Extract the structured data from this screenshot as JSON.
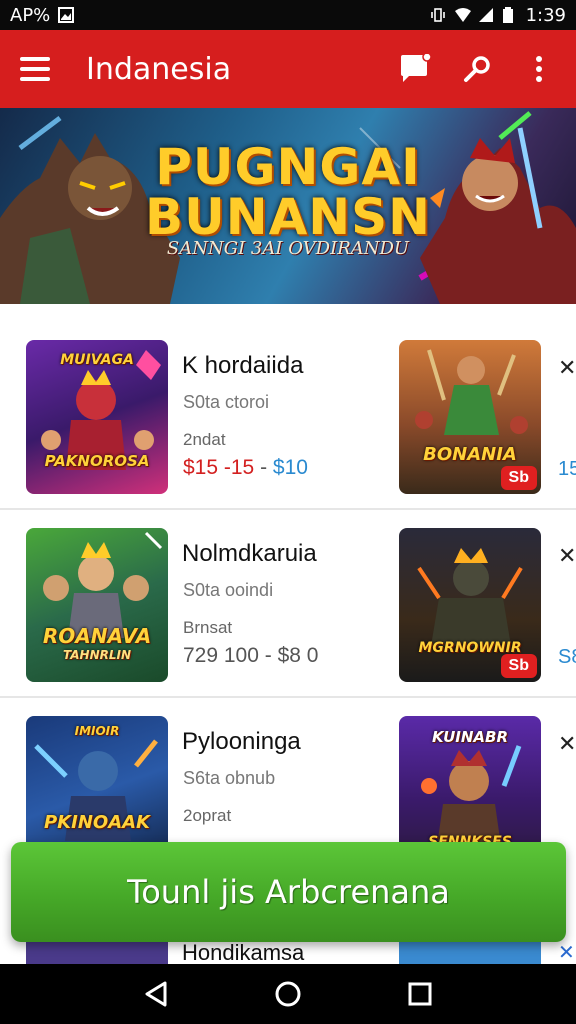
{
  "status_bar": {
    "left_text": "AP%",
    "time": "1:39"
  },
  "app_bar": {
    "title": "Indanesia"
  },
  "banner": {
    "title_line1": "PUGNGAI",
    "title_line2": "BUNANSN",
    "subtitle": "SANNGI 3AI OVDIRANDU"
  },
  "rows": [
    {
      "left_thumb_label": "PAKNOROSA",
      "left_thumb_top": "MUIVAGA",
      "title": "K hordaiida",
      "subtitle": "S0ta ctoroi",
      "label": "2ndat",
      "price_old": "$15 -15",
      "price_sep": " - ",
      "price_new": "$10",
      "right_thumb_label": "BONANIA",
      "badge": "Sb",
      "edge_price": "15"
    },
    {
      "left_thumb_label": "ROANAVA",
      "left_thumb_sub": "TAHNRLIN",
      "title": "Nolmdkaruia",
      "subtitle": "S0ta ooindi",
      "label": "Brnsat",
      "price_old": "729 100",
      "price_sep": " - ",
      "price_new": "$8 0",
      "right_thumb_label": "MGRNOWNIR",
      "badge": "Sb",
      "edge_price": "S8"
    },
    {
      "left_thumb_label": "PKINOAAK",
      "left_thumb_top": "IMIOIR",
      "title": "Pylooninga",
      "subtitle": "S6ta obnub",
      "label": "2oprat",
      "price_old": "",
      "price_sep": "",
      "price_new": "",
      "right_thumb_top": "KUINABR",
      "right_thumb_label": "SENNKSES",
      "badge": "",
      "edge_price": ""
    }
  ],
  "partial_row": {
    "title": "Hondikamsa"
  },
  "cta": {
    "label": "Tounl jis Arbcrenana"
  },
  "colors": {
    "app_bar": "#d61e1e",
    "cta_green": "#46a928",
    "price_red": "#d32020",
    "price_blue": "#2a8ad0"
  },
  "icons": {
    "menu": "hamburger-menu-icon",
    "chat": "chat-notification-icon",
    "search": "search-icon",
    "more": "more-vert-icon",
    "back": "nav-back-icon",
    "home": "nav-home-icon",
    "recents": "nav-recents-icon"
  }
}
